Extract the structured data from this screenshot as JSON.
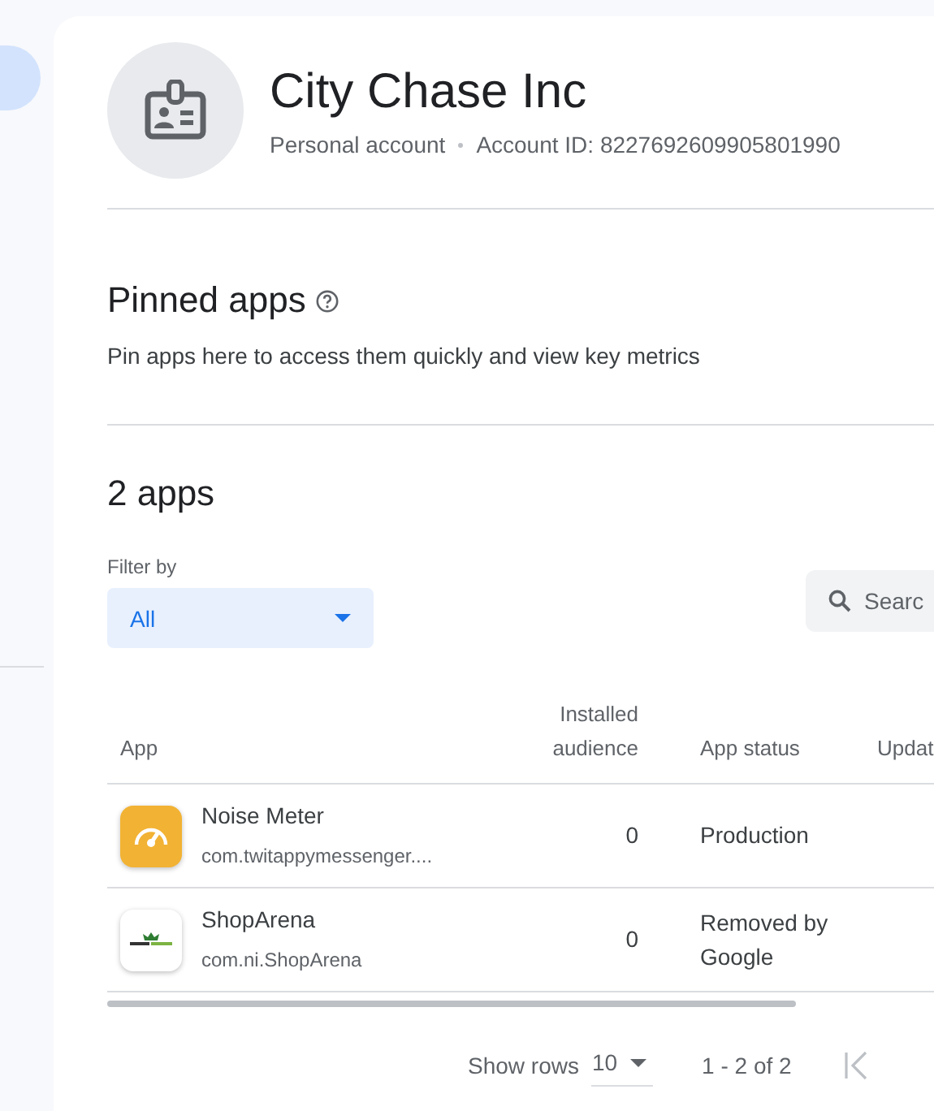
{
  "account": {
    "name": "City Chase Inc",
    "type": "Personal account",
    "id_label": "Account ID: 8227692609905801990"
  },
  "pinned": {
    "title": "Pinned apps",
    "description": "Pin apps here to access them quickly and view key metrics"
  },
  "apps": {
    "title": "2 apps",
    "filter": {
      "label": "Filter by",
      "value": "All"
    },
    "search": {
      "placeholder": "Searc"
    },
    "table": {
      "columns": [
        {
          "label": "App"
        },
        {
          "label": "Installed audience"
        },
        {
          "label": "App status"
        },
        {
          "label": "Updat"
        }
      ],
      "rows": [
        {
          "kind": "meter",
          "name": "Noise Meter",
          "package": "com.twitappymessenger....",
          "audience": "0",
          "status": "Production"
        },
        {
          "kind": "shop",
          "name": "ShopArena",
          "package": "com.ni.ShopArena",
          "audience": "0",
          "status": "Removed by Google"
        }
      ]
    },
    "pagination": {
      "label": "Show rows",
      "rows_per_page": "10",
      "range": "1 - 2 of 2"
    }
  }
}
